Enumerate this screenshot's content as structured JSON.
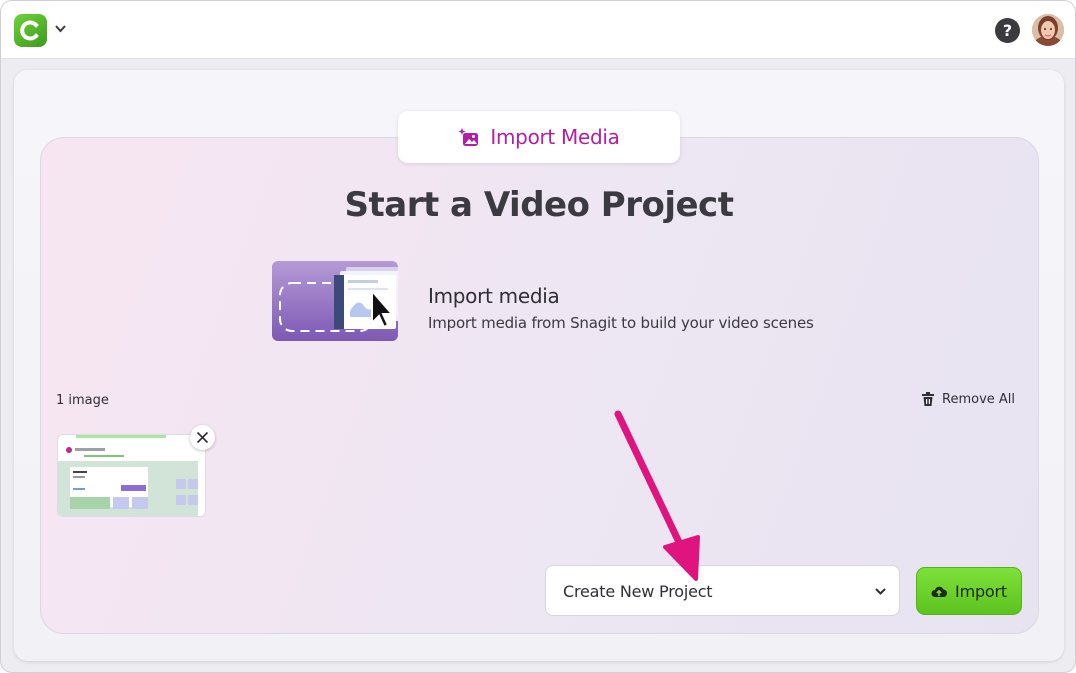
{
  "header": {
    "app_icon": "camtasia-logo-icon",
    "help_glyph": "?"
  },
  "import_tab": {
    "label": "Import Media",
    "icon": "magic-image-icon"
  },
  "main": {
    "title": "Start a Video Project",
    "media_option": {
      "heading": "Import media",
      "description": "Import media from Snagit to build your video scenes"
    },
    "file_count": "1 image",
    "remove_all_label": "Remove All"
  },
  "footer": {
    "project_select_value": "Create New Project",
    "import_button_label": "Import"
  },
  "colors": {
    "accent_magenta": "#b21ea6",
    "import_green": "#6fd42c",
    "annotation_arrow": "#e0147f"
  }
}
